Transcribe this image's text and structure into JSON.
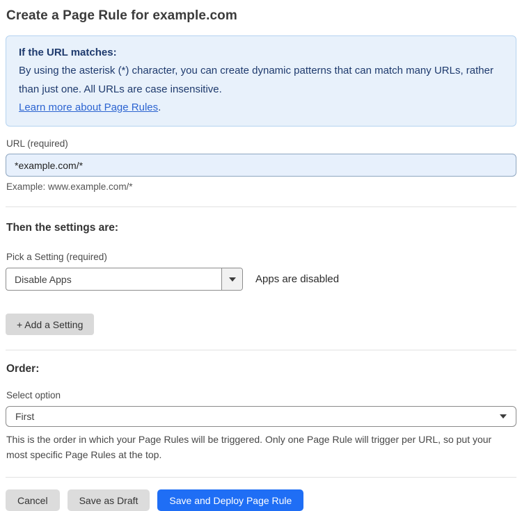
{
  "page": {
    "title": "Create a Page Rule for example.com"
  },
  "info_box": {
    "heading": "If the URL matches:",
    "body": "By using the asterisk (*) character, you can create dynamic patterns that can match many URLs, rather than just one. All URLs are case insensitive.",
    "link_label": "Learn more about Page Rules",
    "link_suffix": "."
  },
  "url_field": {
    "label": "URL (required)",
    "value": "*example.com/*",
    "helper": "Example: www.example.com/*"
  },
  "settings": {
    "heading": "Then the settings are:",
    "picker_label": "Pick a Setting (required)",
    "selected_option": "Disable Apps",
    "status_text": "Apps are disabled",
    "add_button_label": "+ Add a Setting"
  },
  "order": {
    "heading": "Order:",
    "label": "Select option",
    "selected_option": "First",
    "helper": "This is the order in which your Page Rules will be triggered. Only one Page Rule will trigger per URL, so put your most specific Page Rules at the top."
  },
  "actions": {
    "cancel_label": "Cancel",
    "save_draft_label": "Save as Draft",
    "save_deploy_label": "Save and Deploy Page Rule"
  },
  "colors": {
    "accent_blue": "#1f6ef5",
    "info_box_bg": "#e8f1fb",
    "info_box_border": "#b5d3f0",
    "info_text": "#1e3a6d",
    "link_blue": "#2c64d1",
    "input_focus_bg": "#e7f0fc",
    "button_gray": "#dcdcdc"
  }
}
